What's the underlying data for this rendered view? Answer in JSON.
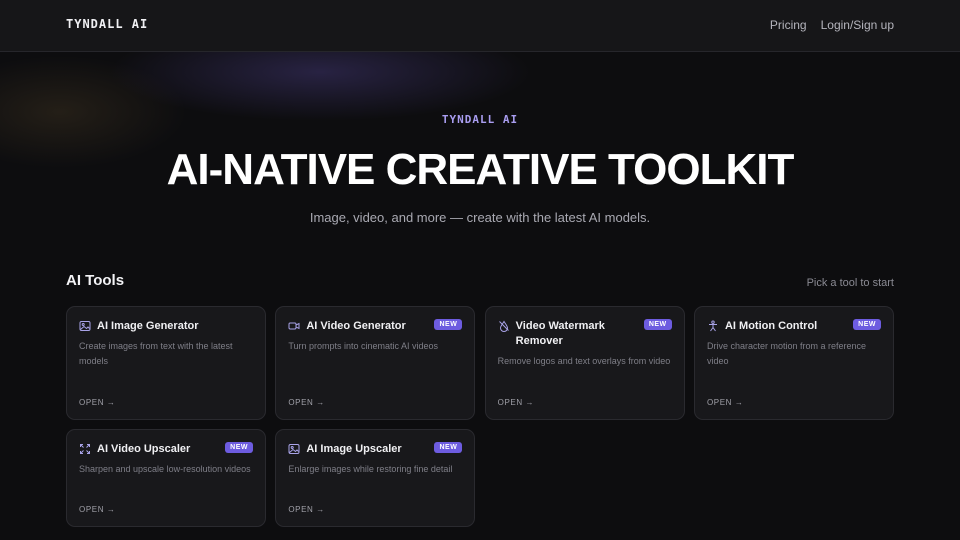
{
  "header": {
    "logo": "TYNDALL AI",
    "nav": [
      {
        "label": "Pricing"
      },
      {
        "label": "Login/Sign up"
      }
    ]
  },
  "hero": {
    "eyebrow": "TYNDALL AI",
    "title": "AI-NATIVE CREATIVE TOOLKIT",
    "subtitle": "Image, video, and more — create with the latest AI models."
  },
  "tools_section": {
    "title": "AI Tools",
    "hint": "Pick a tool to start",
    "cards": [
      {
        "title": "AI Image Generator",
        "badge": "",
        "description": "Create images from text with the latest models",
        "open": "OPEN →",
        "icon": "image-icon"
      },
      {
        "title": "AI Video Generator",
        "badge": "NEW",
        "description": "Turn prompts into cinematic AI videos",
        "open": "OPEN →",
        "icon": "video-camera-icon"
      },
      {
        "title": "Video Watermark Remover",
        "badge": "NEW",
        "description": "Remove logos and text overlays from video",
        "open": "OPEN →",
        "icon": "droplet-icon"
      },
      {
        "title": "AI Motion Control",
        "badge": "NEW",
        "description": "Drive character motion from a reference video",
        "open": "OPEN →",
        "icon": "person-icon"
      },
      {
        "title": "AI Video Upscaler",
        "badge": "NEW",
        "description": "Sharpen and upscale low-resolution videos",
        "open": "OPEN →",
        "icon": "expand-icon"
      },
      {
        "title": "AI Image Upscaler",
        "badge": "NEW",
        "description": "Enlarge images while restoring fine detail",
        "open": "OPEN →",
        "icon": "image-icon"
      }
    ]
  },
  "colors": {
    "accent": "#6d5ce0",
    "eyebrow": "#a99df0",
    "background": "#0d0d0f"
  }
}
